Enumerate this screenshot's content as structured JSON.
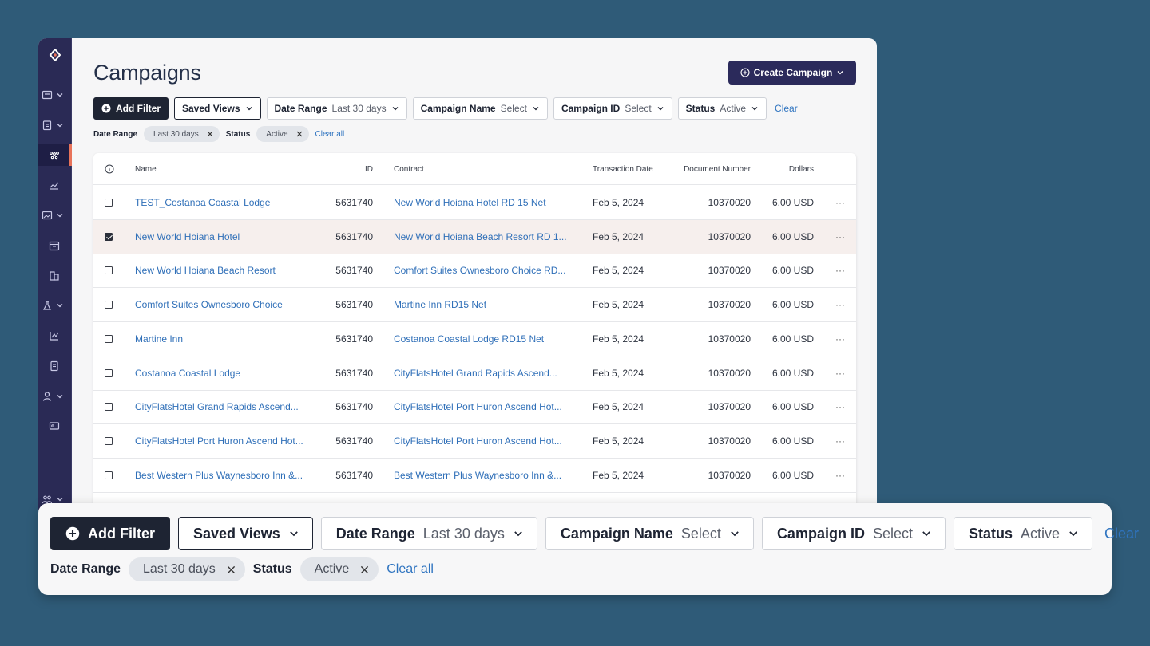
{
  "page": {
    "title": "Campaigns",
    "create_button": "Create Campaign"
  },
  "filters": {
    "add_filter": "Add Filter",
    "saved_views": "Saved Views",
    "date_range": {
      "label": "Date Range",
      "value": "Last 30 days"
    },
    "campaign_name": {
      "label": "Campaign Name",
      "value": "Select"
    },
    "campaign_id": {
      "label": "Campaign ID",
      "value": "Select"
    },
    "status": {
      "label": "Status",
      "value": "Active"
    },
    "clear": "Clear"
  },
  "active_filters": {
    "date_range_label": "Date Range",
    "date_range_chip": "Last 30 days",
    "status_label": "Status",
    "status_chip": "Active",
    "clear_all": "Clear all"
  },
  "table": {
    "columns": [
      "Name",
      "ID",
      "Contract",
      "Transaction Date",
      "Document Number",
      "Dollars"
    ],
    "rows": [
      {
        "name": "TEST_Costanoa Coastal Lodge",
        "id": "5631740",
        "contract": "New World Hoiana Hotel RD 15 Net",
        "date": "Feb 5, 2024",
        "doc": "10370020",
        "dollars": "6.00 USD",
        "checked": false
      },
      {
        "name": "New World Hoiana Hotel",
        "id": "5631740",
        "contract": "New World Hoiana Beach Resort RD 1...",
        "date": "Feb 5, 2024",
        "doc": "10370020",
        "dollars": "6.00 USD",
        "checked": true
      },
      {
        "name": "New World Hoiana Beach Resort",
        "id": "5631740",
        "contract": "Comfort Suites Ownesboro Choice RD...",
        "date": "Feb 5, 2024",
        "doc": "10370020",
        "dollars": "6.00 USD",
        "checked": false
      },
      {
        "name": "Comfort Suites Ownesboro Choice",
        "id": "5631740",
        "contract": "Martine Inn RD15 Net",
        "date": "Feb 5, 2024",
        "doc": "10370020",
        "dollars": "6.00 USD",
        "checked": false
      },
      {
        "name": "Martine Inn",
        "id": "5631740",
        "contract": "Costanoa Coastal Lodge RD15 Net",
        "date": "Feb 5, 2024",
        "doc": "10370020",
        "dollars": "6.00 USD",
        "checked": false
      },
      {
        "name": "Costanoa Coastal Lodge",
        "id": "5631740",
        "contract": "CityFlatsHotel Grand Rapids Ascend...",
        "date": "Feb 5, 2024",
        "doc": "10370020",
        "dollars": "6.00 USD",
        "checked": false
      },
      {
        "name": "CityFlatsHotel Grand Rapids Ascend...",
        "id": "5631740",
        "contract": "CityFlatsHotel Port Huron Ascend Hot...",
        "date": "Feb 5, 2024",
        "doc": "10370020",
        "dollars": "6.00 USD",
        "checked": false
      },
      {
        "name": "CityFlatsHotel Port Huron Ascend Hot...",
        "id": "5631740",
        "contract": "CityFlatsHotel Port Huron Ascend Hot...",
        "date": "Feb 5, 2024",
        "doc": "10370020",
        "dollars": "6.00 USD",
        "checked": false
      },
      {
        "name": "Best Western Plus Waynesboro Inn &...",
        "id": "5631740",
        "contract": "Best Western Plus Waynesboro Inn &...",
        "date": "Feb 5, 2024",
        "doc": "10370020",
        "dollars": "6.00 USD",
        "checked": false
      }
    ],
    "more_glyph": "···"
  },
  "colors": {
    "sidebar": "#2a2a55",
    "primary_button": "#2b2a5b",
    "dark_button": "#1e2433",
    "link": "#2f6fb8",
    "active_indicator": "#e8735a",
    "background": "#2f5b78"
  },
  "sidebar_icons": [
    "logo-icon",
    "inbox-icon",
    "clipboard-icon",
    "network-icon",
    "chart-line-icon",
    "image-icon",
    "calendar-icon",
    "building-icon",
    "flask-icon",
    "analytics-icon",
    "document-icon",
    "user-icon",
    "id-card-icon",
    "people-icon"
  ]
}
